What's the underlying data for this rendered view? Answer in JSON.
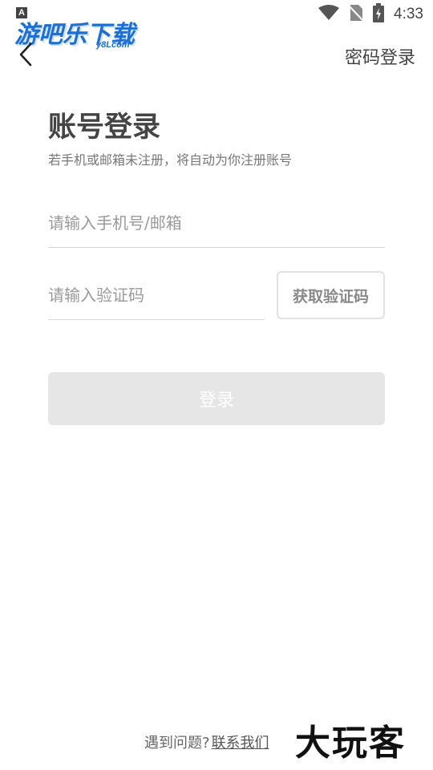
{
  "status_bar": {
    "badge": "A",
    "time": "4:33",
    "icons": [
      "wifi-icon",
      "no-sim-icon",
      "battery-charging-icon"
    ]
  },
  "watermark": {
    "text": "游吧乐下载",
    "sub": "y8Lcom"
  },
  "topbar": {
    "back_icon": "chevron-left-icon",
    "password_login": "密码登录"
  },
  "form": {
    "title": "账号登录",
    "subtitle": "若手机或邮箱未注册，将自动为你注册账号",
    "phone_placeholder": "请输入手机号/邮箱",
    "code_placeholder": "请输入验证码",
    "get_code": "获取验证码",
    "login": "登录"
  },
  "footer": {
    "question": "遇到问题?",
    "contact": "联系我们",
    "brand": "大玩客"
  },
  "colors": {
    "watermark": "#1d6fd6",
    "login_disabled": "#e6e6e6"
  }
}
